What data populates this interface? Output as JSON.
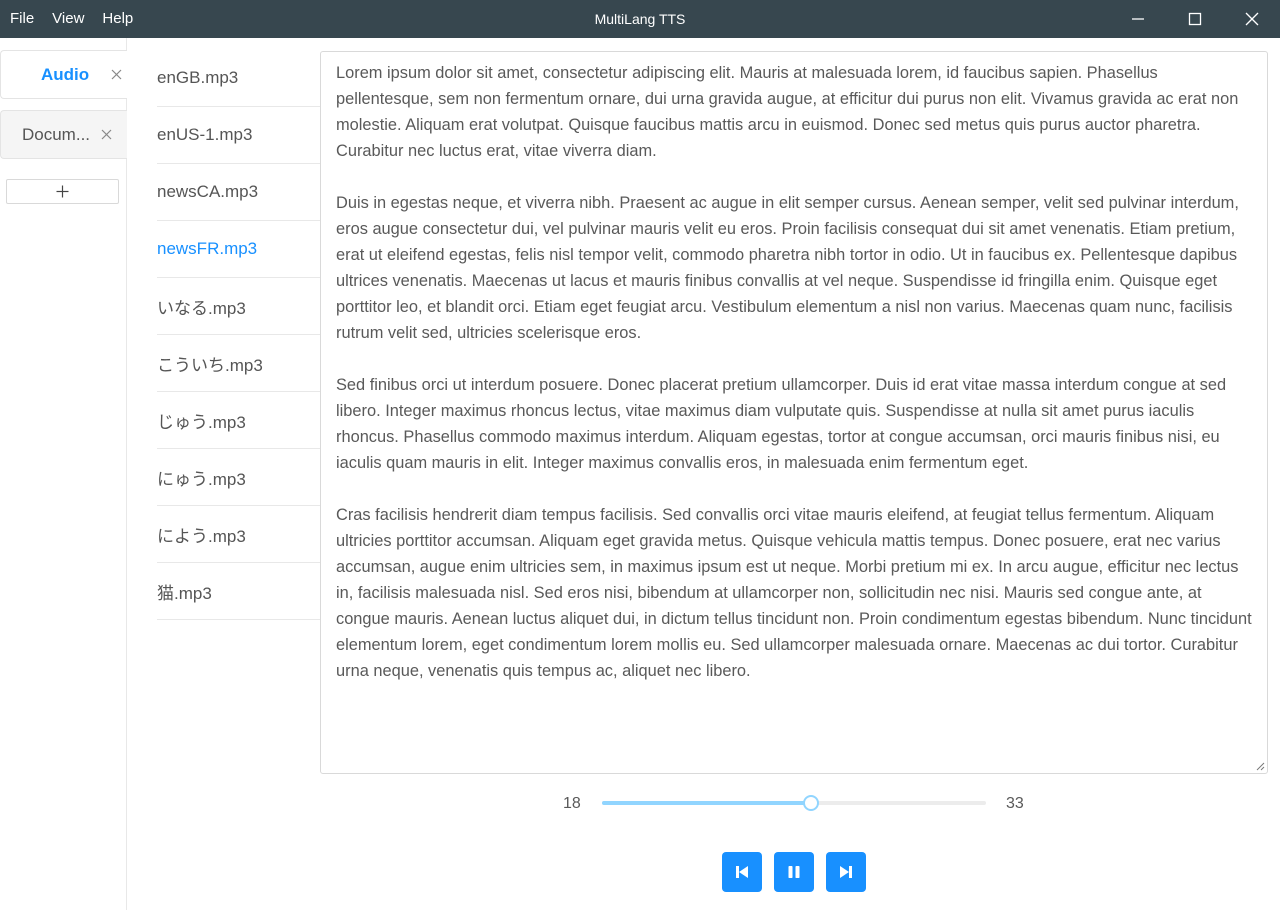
{
  "window": {
    "title": "MultiLang TTS",
    "menu": [
      "File",
      "View",
      "Help"
    ]
  },
  "tabs": [
    {
      "label": "Audio",
      "active": true
    },
    {
      "label": "Docum...",
      "active": false
    }
  ],
  "add_tab_label": "+",
  "files": [
    "enGB.mp3",
    "enUS-1.mp3",
    "newsCA.mp3",
    "newsFR.mp3",
    "いなる.mp3",
    "こういち.mp3",
    "じゅう.mp3",
    "にゅう.mp3",
    "によう.mp3",
    "猫.mp3"
  ],
  "selected_file": "newsFR.mp3",
  "document": {
    "paragraphs": [
      "Lorem ipsum dolor sit amet, consectetur adipiscing elit. Mauris at malesuada lorem, id faucibus sapien. Phasellus pellentesque, sem non fermentum ornare, dui urna gravida augue, at efficitur dui purus non elit. Vivamus gravida ac erat non molestie. Aliquam erat volutpat. Quisque faucibus mattis arcu in euismod. Donec sed metus quis purus auctor pharetra. Curabitur nec luctus erat, vitae viverra diam.",
      "Duis in egestas neque, et viverra nibh. Praesent ac augue in elit semper cursus. Aenean semper, velit sed pulvinar interdum, eros augue consectetur dui, vel pulvinar mauris velit eu eros. Proin facilisis consequat dui sit amet venenatis. Etiam pretium, erat ut eleifend egestas, felis nisl tempor velit, commodo pharetra nibh tortor in odio. Ut in faucibus ex. Pellentesque dapibus ultrices venenatis. Maecenas ut lacus et mauris finibus convallis at vel neque. Suspendisse id fringilla enim. Quisque eget porttitor leo, et blandit orci. Etiam eget feugiat arcu. Vestibulum elementum a nisl non varius. Maecenas quam nunc, facilisis rutrum velit sed, ultricies scelerisque eros.",
      "Sed finibus orci ut interdum posuere. Donec placerat pretium ullamcorper. Duis id erat vitae massa interdum congue at sed libero. Integer maximus rhoncus lectus, vitae maximus diam vulputate quis. Suspendisse at nulla sit amet purus iaculis rhoncus. Phasellus commodo maximus interdum. Aliquam egestas, tortor at congue accumsan, orci mauris finibus nisi, eu iaculis quam mauris in elit. Integer maximus convallis eros, in malesuada enim fermentum eget.",
      "Cras facilisis hendrerit diam tempus facilisis. Sed convallis orci vitae mauris eleifend, at feugiat tellus fermentum. Aliquam ultricies porttitor accumsan. Aliquam eget gravida metus. Quisque vehicula mattis tempus. Donec posuere, erat nec varius accumsan, augue enim ultricies sem, in maximus ipsum est ut neque. Morbi pretium mi ex. In arcu augue, efficitur nec lectus in, facilisis malesuada nisl. Sed eros nisi, bibendum at ullamcorper non, sollicitudin nec nisi. Mauris sed congue ante, at congue mauris. Aenean luctus aliquet dui, in dictum tellus tincidunt non. Proin condimentum egestas bibendum. Nunc tincidunt elementum lorem, eget condimentum lorem mollis eu. Sed ullamcorper malesuada ornare. Maecenas ac dui tortor. Curabitur urna neque, venenatis quis tempus ac, aliquet nec libero."
    ]
  },
  "slider": {
    "min_label": "18",
    "max_label": "33",
    "value_fraction": 0.545
  },
  "player": {
    "buttons": [
      "previous",
      "pause",
      "next"
    ]
  },
  "colors": {
    "titlebar": "#37474f",
    "accent": "#1890ff",
    "slider_fill": "#91d5ff"
  },
  "icons": {
    "minimize": "minimize-icon",
    "maximize": "maximize-icon",
    "close": "close-icon",
    "tab_close": "close-icon",
    "add": "plus-icon",
    "previous": "skip-previous-icon",
    "pause": "pause-icon",
    "next": "skip-next-icon"
  }
}
